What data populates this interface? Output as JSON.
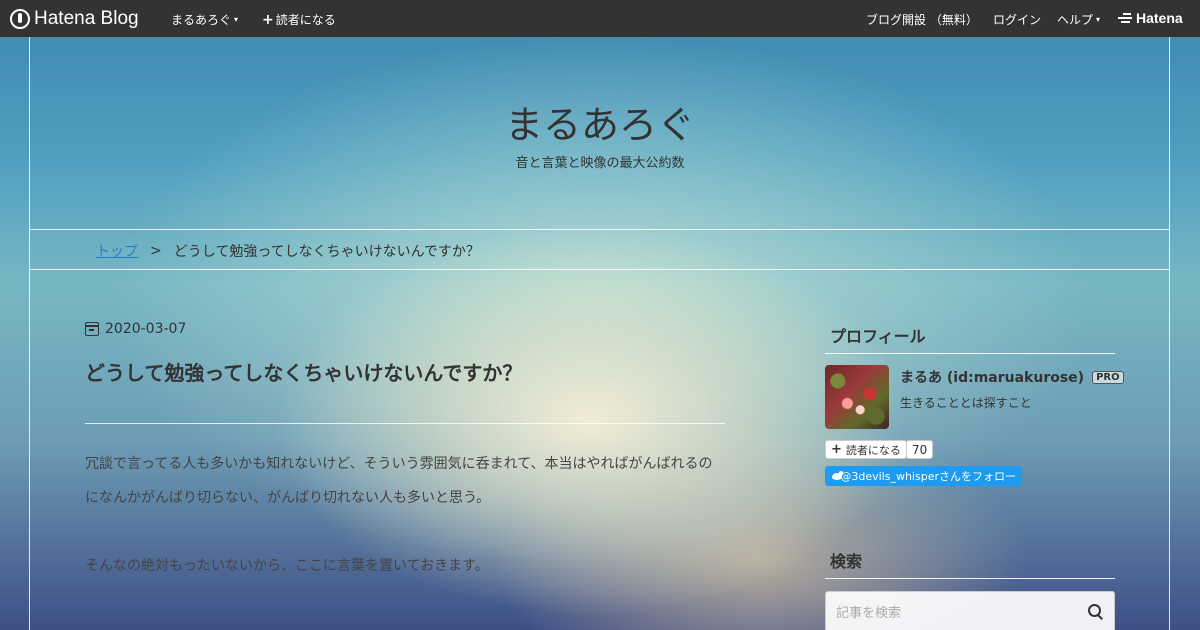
{
  "topbar": {
    "logo_text": "Hatena Blog",
    "blog_menu": "まるあろぐ",
    "subscribe": "読者になる",
    "open_blog": "ブログ開設 （無料）",
    "login": "ログイン",
    "help": "ヘルプ",
    "hatena": "Hatena"
  },
  "header": {
    "title": "まるあろぐ",
    "description": "音と言葉と映像の最大公約数"
  },
  "breadcrumb": {
    "top": "トップ",
    "separator": ">",
    "current": "どうして勉強ってしなくちゃいけないんですか？"
  },
  "entry": {
    "date": "2020-03-07",
    "title": "どうして勉強ってしなくちゃいけないんですか？",
    "paragraphs": [
      "冗談で言ってる人も多いかも知れないけど、そういう雰囲気に呑まれて、本当はやればがんばれるのになんかがんばり切らない、がんばり切れない人も多いと思う。",
      "そんなの絶対もったいないから、ここに言葉を置いておきます。"
    ]
  },
  "sidebar": {
    "profile_heading": "プロフィール",
    "profile_name": "まるあ (id:maruakurose)",
    "pro_badge": "PRO",
    "profile_desc": "生きることとは探すこと",
    "subscribe_label": "読者になる",
    "subscriber_count": "70",
    "twitter_follow": "@3devils_whisperさんをフォロー",
    "search_heading": "検索",
    "search_placeholder": "記事を検索"
  },
  "colors": {
    "topbar": "#333333",
    "link": "#2a7ec0",
    "twitter": "#1d9bf0"
  }
}
